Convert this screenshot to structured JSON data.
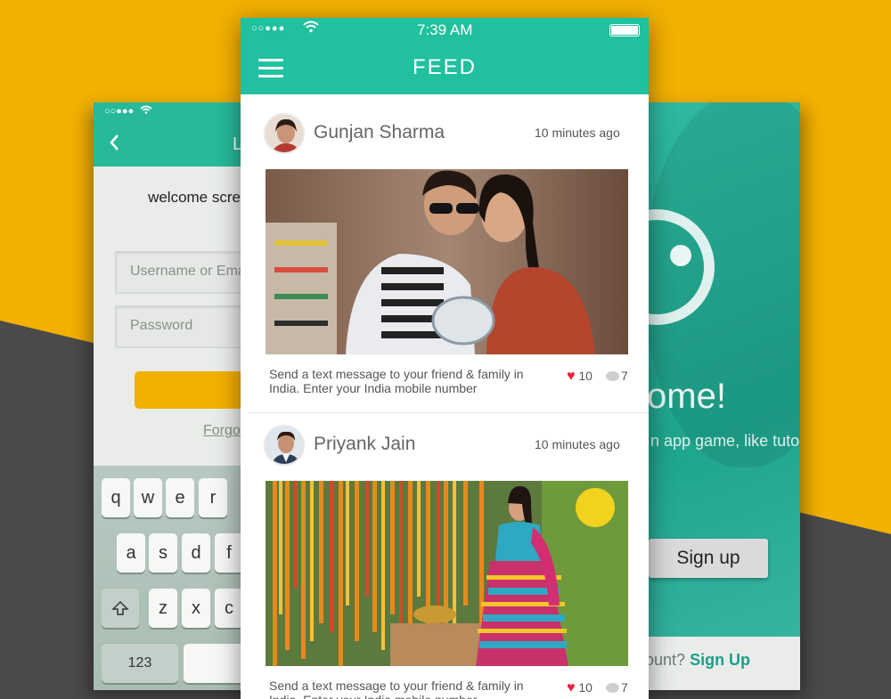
{
  "colors": {
    "accent": "#21c09e",
    "background": "#f2b000",
    "dark_band": "#4a4a4a",
    "like": "#e8213b"
  },
  "login_screen": {
    "status_signal": "○○●●●",
    "back_icon": "chevron-left-icon",
    "title_fragment": "L",
    "welcome_text": "welcome screen etc. In",
    "username_placeholder": "Username or Ema",
    "password_placeholder": "Password",
    "forgot_text": "Forgo",
    "keyboard": {
      "row1": [
        "q",
        "w",
        "e",
        "r"
      ],
      "row2": [
        "a",
        "s",
        "d",
        "f"
      ],
      "row3": [
        "z",
        "x",
        "c"
      ],
      "shift_icon": "shift-icon",
      "numbers_key": "123"
    }
  },
  "feed_screen": {
    "status": {
      "signal": "○○●●●",
      "time": "7:39 AM"
    },
    "header": {
      "menu_icon": "hamburger-menu-icon",
      "title": "FEED"
    },
    "posts": [
      {
        "user": "Gunjan Sharma",
        "time": "10 minutes ago",
        "text": "Send a text message to your friend & family in India. Enter your India mobile number",
        "likes": "10",
        "comments": "7"
      },
      {
        "user": "Priyank Jain",
        "time": "10 minutes ago",
        "text": "Send a text message to your friend & family in India. Enter your India mobile number",
        "likes": "10",
        "comments": "7"
      }
    ]
  },
  "welcome_screen": {
    "logo_icon": "person-circle-logo-icon",
    "welcome_fragment": "ome!",
    "description": "n app game, like tutorial,",
    "signup_label": "Sign up",
    "bottom_text": "ount?",
    "bottom_link": "Sign Up"
  }
}
